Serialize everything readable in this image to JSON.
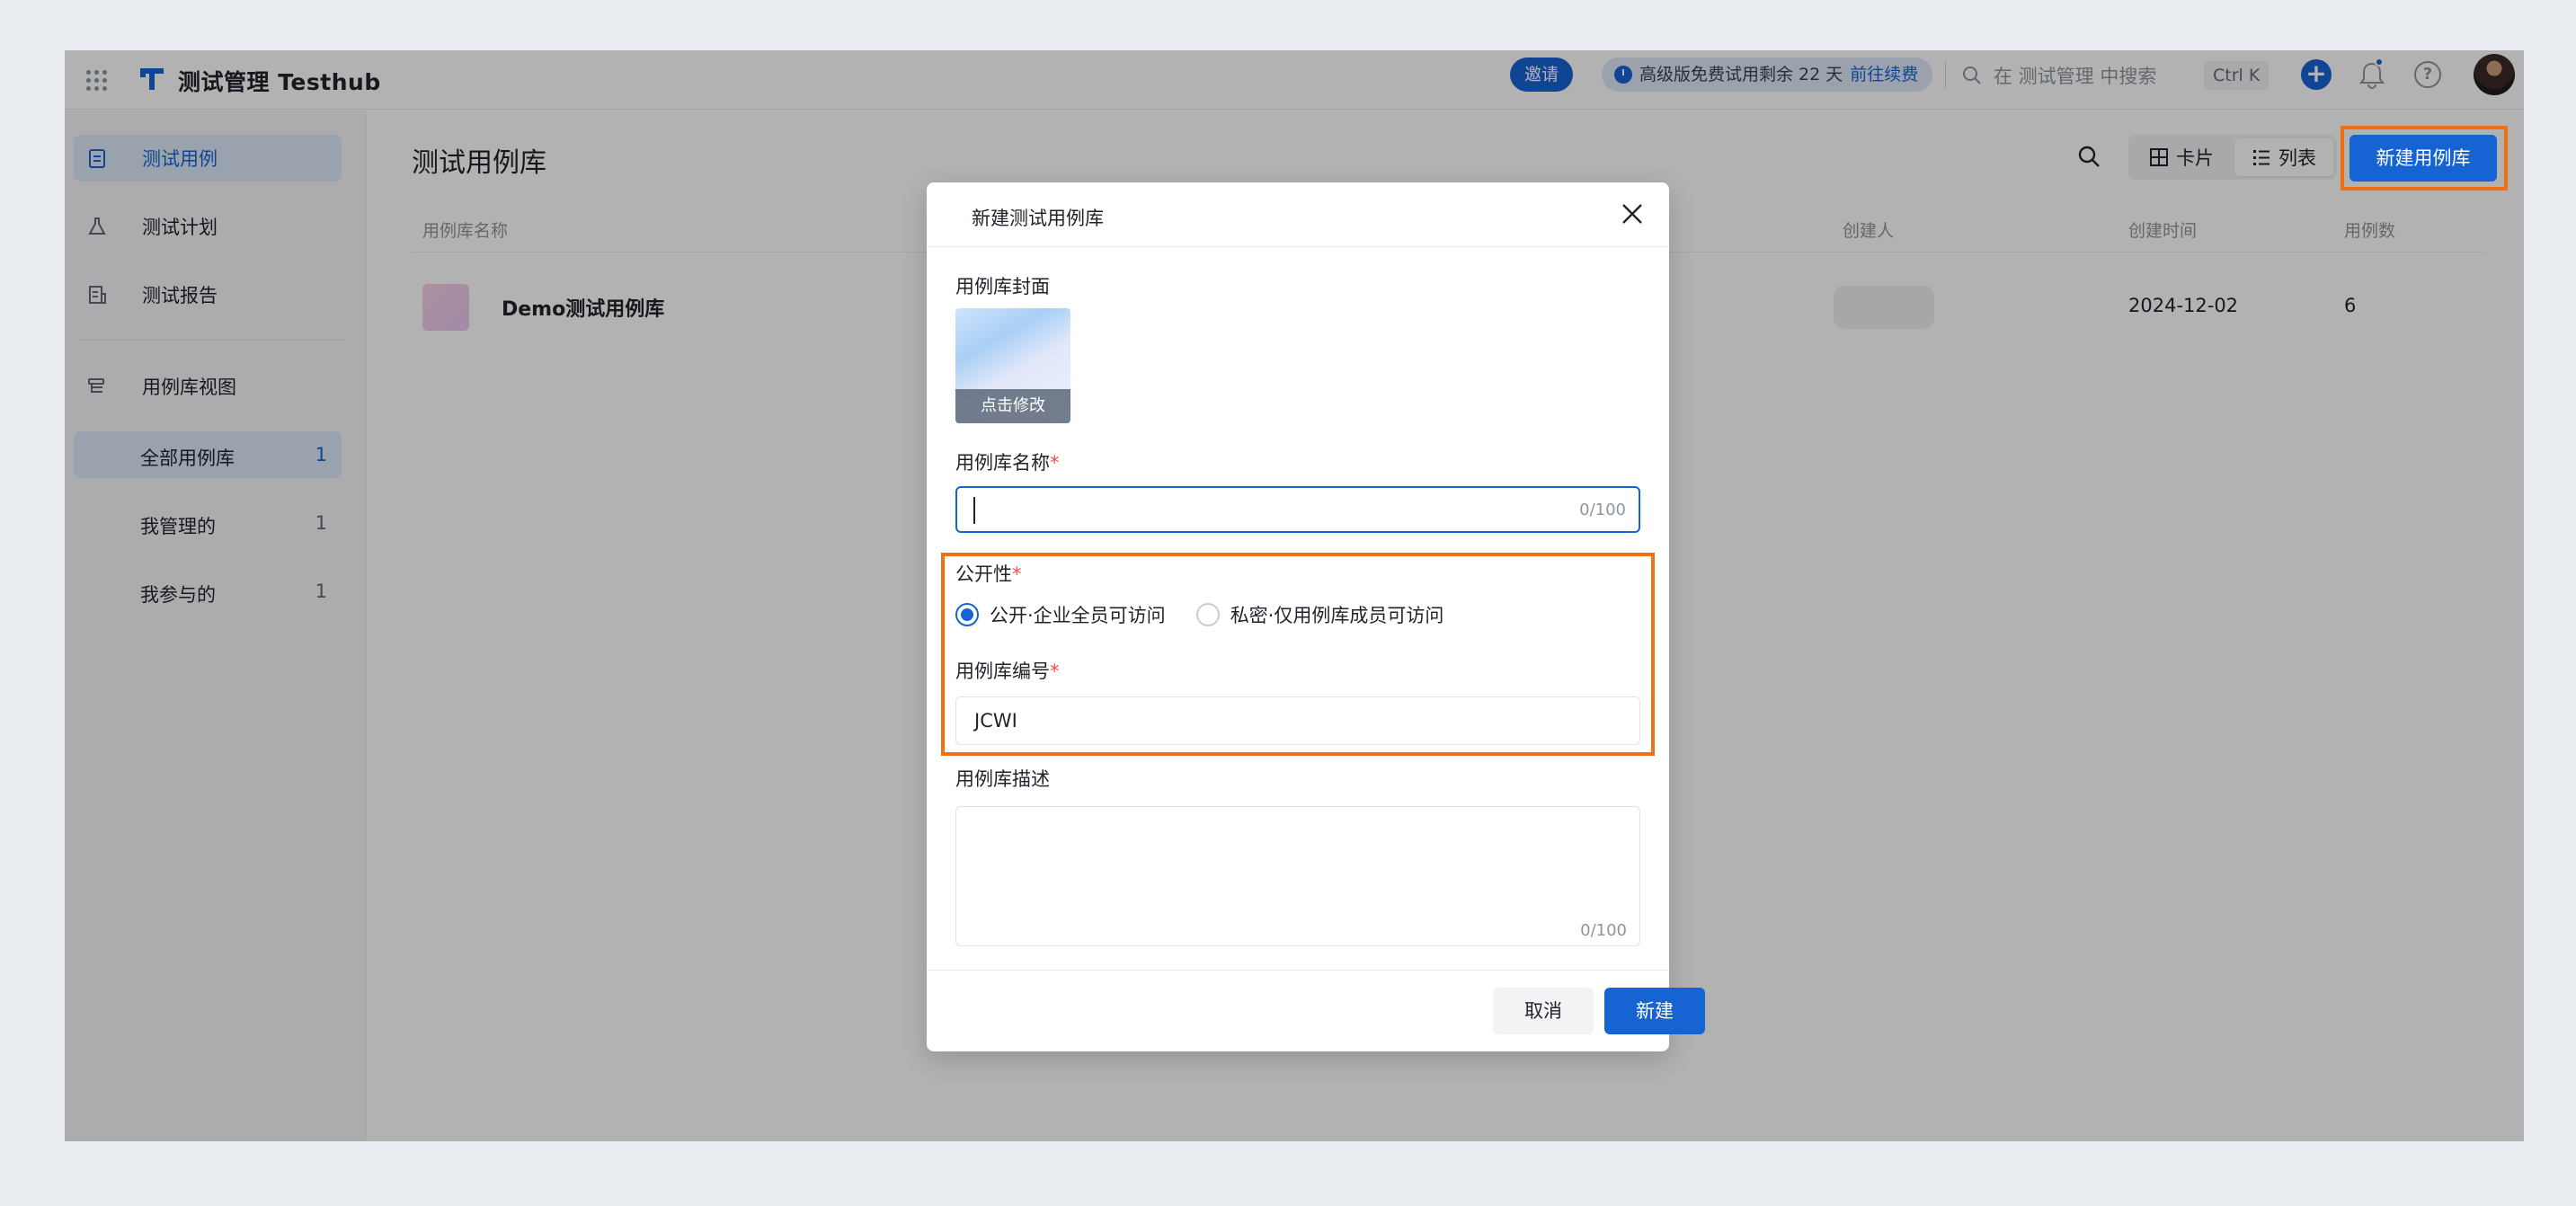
{
  "topbar": {
    "title": "测试管理 Testhub",
    "invite_label": "邀请",
    "trial_text": "高级版免费试用剩余 22 天",
    "renew_link": "前往续费",
    "search_placeholder": "在 测试管理 中搜索",
    "shortcut": "Ctrl K",
    "help_glyph": "?"
  },
  "sidebar": {
    "items": [
      {
        "label": "测试用例",
        "icon": "clipboard-icon",
        "active": true
      },
      {
        "label": "测试计划",
        "icon": "flask-icon"
      },
      {
        "label": "测试报告",
        "icon": "report-icon"
      }
    ],
    "view_section": {
      "label": "用例库视图",
      "icon": "tree-view-icon"
    },
    "views": [
      {
        "label": "全部用例库",
        "count": "1",
        "active": true
      },
      {
        "label": "我管理的",
        "count": "1"
      },
      {
        "label": "我参与的",
        "count": "1"
      }
    ]
  },
  "main": {
    "title": "测试用例库",
    "view_card_label": "卡片",
    "view_list_label": "列表",
    "new_button_label": "新建用例库",
    "columns": [
      "用例库名称",
      "创建人",
      "创建时间",
      "用例数"
    ],
    "rows": [
      {
        "name": "Demo测试用例库",
        "creator": "",
        "created": "2024-12-02",
        "count": "6"
      }
    ]
  },
  "modal": {
    "title": "新建测试用例库",
    "cover_label": "用例库封面",
    "cover_edit": "点击修改",
    "name_label": "用例库名称",
    "name_value": "",
    "name_counter": "0/100",
    "required_mark": "*",
    "visibility_label": "公开性",
    "visibility_options": [
      {
        "label": "公开·企业全员可访问",
        "selected": true
      },
      {
        "label": "私密·仅用例库成员可访问",
        "selected": false
      }
    ],
    "code_label": "用例库编号",
    "code_value": "JCWI",
    "desc_label": "用例库描述",
    "desc_counter": "0/100",
    "cancel_label": "取消",
    "create_label": "新建"
  },
  "colors": {
    "primary": "#1664d4",
    "highlight": "#f07114",
    "required": "#f54a45"
  }
}
